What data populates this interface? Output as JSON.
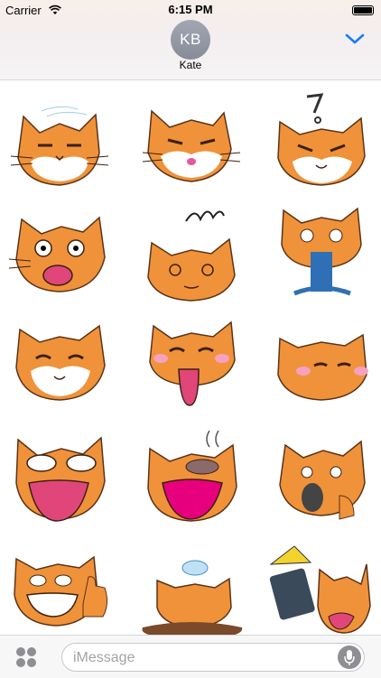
{
  "status_bar": {
    "carrier": "Carrier",
    "time": "6:15 PM"
  },
  "header": {
    "avatar_initials": "KB",
    "contact_name": "Kate"
  },
  "stickers": [
    {
      "icon": "sleepy-cat-sticker"
    },
    {
      "icon": "smug-cat-sticker"
    },
    {
      "icon": "angry-cat-sticker"
    },
    {
      "icon": "shocked-cat-sticker"
    },
    {
      "icon": "dizzy-cat-sticker"
    },
    {
      "icon": "vomiting-cat-sticker"
    },
    {
      "icon": "happy-cat-sticker"
    },
    {
      "icon": "tongue-out-cat-sticker"
    },
    {
      "icon": "blushing-cat-sticker"
    },
    {
      "icon": "laughing-cat-sticker"
    },
    {
      "icon": "yawning-cat-sticker"
    },
    {
      "icon": "hand-over-mouth-cat-sticker"
    },
    {
      "icon": "thumbs-up-cat-sticker"
    },
    {
      "icon": "melting-cat-sticker"
    },
    {
      "icon": "phone-cat-sticker"
    }
  ],
  "input_bar": {
    "placeholder": "iMessage"
  },
  "colors": {
    "cat_orange": "#F0923A",
    "cat_white": "#FFFFFF",
    "outline": "#5A3318"
  }
}
